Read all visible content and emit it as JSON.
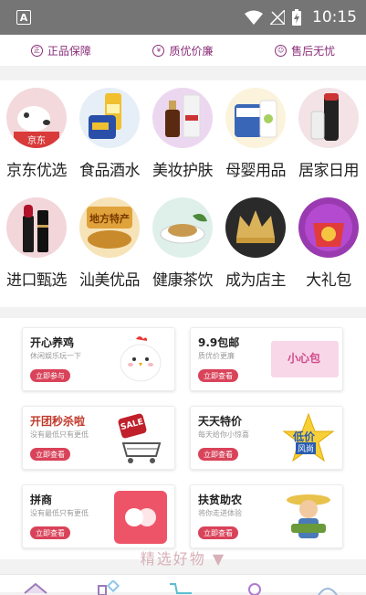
{
  "status_bar": {
    "time": "10:15",
    "app_badge": "A"
  },
  "guarantee": [
    {
      "label": "正品保障",
      "icon": "authentic-icon"
    },
    {
      "label": "质优价廉",
      "icon": "price-icon"
    },
    {
      "label": "售后无忧",
      "icon": "aftersale-icon"
    }
  ],
  "categories": [
    {
      "label": "京东优选",
      "icon": "jd-dog-icon"
    },
    {
      "label": "食品酒水",
      "icon": "food-drink-icon"
    },
    {
      "label": "美妆护肤",
      "icon": "cosmetics-icon"
    },
    {
      "label": "母婴用品",
      "icon": "baby-products-icon"
    },
    {
      "label": "居家日用",
      "icon": "home-goods-icon"
    },
    {
      "label": "进口甄选",
      "icon": "import-lipstick-icon"
    },
    {
      "label": "汕美优品",
      "icon": "local-specialty-icon"
    },
    {
      "label": "健康茶饮",
      "icon": "tea-icon"
    },
    {
      "label": "成为店主",
      "icon": "crown-icon"
    },
    {
      "label": "大礼包",
      "icon": "gift-bag-icon"
    }
  ],
  "category_badges": {
    "jd": "京东",
    "local": "地方特产"
  },
  "promos": [
    {
      "title": "开心养鸡",
      "subtitle": "休闲娱乐玩一下",
      "button": "立即参与",
      "icon": "chicken-icon"
    },
    {
      "title": "9.9包邮",
      "subtitle": "质优价更廉",
      "button": "立即查看",
      "icon": "product-pack-icon"
    },
    {
      "title": "开团秒杀啦",
      "subtitle": "没有最低只有更低",
      "button": "立即查看",
      "icon": "sale-cart-icon"
    },
    {
      "title": "天天特价",
      "subtitle": "每天给你小惊喜",
      "button": "立即查看",
      "icon": "low-price-star-icon"
    },
    {
      "title": "拼商",
      "subtitle": "没有最低只有更低",
      "button": "立即查看",
      "icon": "pin-shang-icon"
    },
    {
      "title": "扶贫助农",
      "subtitle": "将你走进体验",
      "button": "立即查看",
      "icon": "farmer-icon"
    }
  ],
  "promo_badges": {
    "sale": "SALE",
    "low_price": "低价",
    "style": "风尚",
    "pack": "小心包"
  },
  "section_title": "精选好物 ▼"
}
